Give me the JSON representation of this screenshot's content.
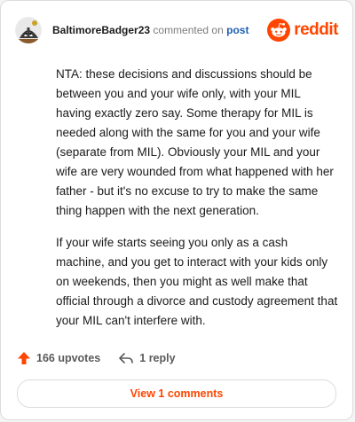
{
  "comment": {
    "username": "BaltimoreBadger23",
    "commented_text": "commented on",
    "post_link": "post",
    "paragraphs": [
      "NTA: these decisions and discussions should be between you and your wife only, with your MIL having exactly zero say. Some therapy for MIL is needed along with the same for you and your wife (separate from MIL). Obviously your MIL and your wife are very wounded from what happened with her father - but it's no excuse to try to make the same thing happen with the next generation.",
      "If your wife starts seeing you only as a cash machine, and you get to interact with your kids only on weekends, then you might as well make that official through a divorce and custody agreement that your MIL can't interfere with."
    ]
  },
  "brand": {
    "wordmark": "reddit",
    "icon": "reddit-alien-icon",
    "color": "#ff4500"
  },
  "footer": {
    "upvotes_label": "166 upvotes",
    "upvote_icon": "upvote-arrow-icon",
    "reply_label": "1 reply",
    "reply_icon": "reply-arrow-icon",
    "view_comments_label": "View 1 comments"
  }
}
